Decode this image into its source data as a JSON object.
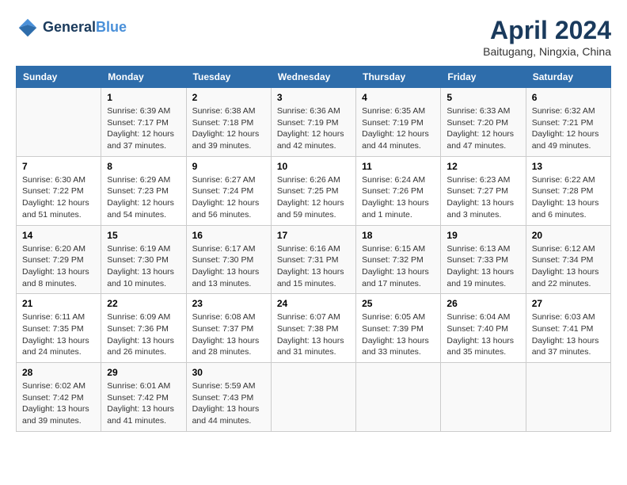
{
  "header": {
    "logo_line1": "General",
    "logo_line2": "Blue",
    "title": "April 2024",
    "location": "Baitugang, Ningxia, China"
  },
  "weekdays": [
    "Sunday",
    "Monday",
    "Tuesday",
    "Wednesday",
    "Thursday",
    "Friday",
    "Saturday"
  ],
  "weeks": [
    [
      {
        "day": "",
        "info": ""
      },
      {
        "day": "1",
        "info": "Sunrise: 6:39 AM\nSunset: 7:17 PM\nDaylight: 12 hours\nand 37 minutes."
      },
      {
        "day": "2",
        "info": "Sunrise: 6:38 AM\nSunset: 7:18 PM\nDaylight: 12 hours\nand 39 minutes."
      },
      {
        "day": "3",
        "info": "Sunrise: 6:36 AM\nSunset: 7:19 PM\nDaylight: 12 hours\nand 42 minutes."
      },
      {
        "day": "4",
        "info": "Sunrise: 6:35 AM\nSunset: 7:19 PM\nDaylight: 12 hours\nand 44 minutes."
      },
      {
        "day": "5",
        "info": "Sunrise: 6:33 AM\nSunset: 7:20 PM\nDaylight: 12 hours\nand 47 minutes."
      },
      {
        "day": "6",
        "info": "Sunrise: 6:32 AM\nSunset: 7:21 PM\nDaylight: 12 hours\nand 49 minutes."
      }
    ],
    [
      {
        "day": "7",
        "info": "Sunrise: 6:30 AM\nSunset: 7:22 PM\nDaylight: 12 hours\nand 51 minutes."
      },
      {
        "day": "8",
        "info": "Sunrise: 6:29 AM\nSunset: 7:23 PM\nDaylight: 12 hours\nand 54 minutes."
      },
      {
        "day": "9",
        "info": "Sunrise: 6:27 AM\nSunset: 7:24 PM\nDaylight: 12 hours\nand 56 minutes."
      },
      {
        "day": "10",
        "info": "Sunrise: 6:26 AM\nSunset: 7:25 PM\nDaylight: 12 hours\nand 59 minutes."
      },
      {
        "day": "11",
        "info": "Sunrise: 6:24 AM\nSunset: 7:26 PM\nDaylight: 13 hours\nand 1 minute."
      },
      {
        "day": "12",
        "info": "Sunrise: 6:23 AM\nSunset: 7:27 PM\nDaylight: 13 hours\nand 3 minutes."
      },
      {
        "day": "13",
        "info": "Sunrise: 6:22 AM\nSunset: 7:28 PM\nDaylight: 13 hours\nand 6 minutes."
      }
    ],
    [
      {
        "day": "14",
        "info": "Sunrise: 6:20 AM\nSunset: 7:29 PM\nDaylight: 13 hours\nand 8 minutes."
      },
      {
        "day": "15",
        "info": "Sunrise: 6:19 AM\nSunset: 7:30 PM\nDaylight: 13 hours\nand 10 minutes."
      },
      {
        "day": "16",
        "info": "Sunrise: 6:17 AM\nSunset: 7:30 PM\nDaylight: 13 hours\nand 13 minutes."
      },
      {
        "day": "17",
        "info": "Sunrise: 6:16 AM\nSunset: 7:31 PM\nDaylight: 13 hours\nand 15 minutes."
      },
      {
        "day": "18",
        "info": "Sunrise: 6:15 AM\nSunset: 7:32 PM\nDaylight: 13 hours\nand 17 minutes."
      },
      {
        "day": "19",
        "info": "Sunrise: 6:13 AM\nSunset: 7:33 PM\nDaylight: 13 hours\nand 19 minutes."
      },
      {
        "day": "20",
        "info": "Sunrise: 6:12 AM\nSunset: 7:34 PM\nDaylight: 13 hours\nand 22 minutes."
      }
    ],
    [
      {
        "day": "21",
        "info": "Sunrise: 6:11 AM\nSunset: 7:35 PM\nDaylight: 13 hours\nand 24 minutes."
      },
      {
        "day": "22",
        "info": "Sunrise: 6:09 AM\nSunset: 7:36 PM\nDaylight: 13 hours\nand 26 minutes."
      },
      {
        "day": "23",
        "info": "Sunrise: 6:08 AM\nSunset: 7:37 PM\nDaylight: 13 hours\nand 28 minutes."
      },
      {
        "day": "24",
        "info": "Sunrise: 6:07 AM\nSunset: 7:38 PM\nDaylight: 13 hours\nand 31 minutes."
      },
      {
        "day": "25",
        "info": "Sunrise: 6:05 AM\nSunset: 7:39 PM\nDaylight: 13 hours\nand 33 minutes."
      },
      {
        "day": "26",
        "info": "Sunrise: 6:04 AM\nSunset: 7:40 PM\nDaylight: 13 hours\nand 35 minutes."
      },
      {
        "day": "27",
        "info": "Sunrise: 6:03 AM\nSunset: 7:41 PM\nDaylight: 13 hours\nand 37 minutes."
      }
    ],
    [
      {
        "day": "28",
        "info": "Sunrise: 6:02 AM\nSunset: 7:42 PM\nDaylight: 13 hours\nand 39 minutes."
      },
      {
        "day": "29",
        "info": "Sunrise: 6:01 AM\nSunset: 7:42 PM\nDaylight: 13 hours\nand 41 minutes."
      },
      {
        "day": "30",
        "info": "Sunrise: 5:59 AM\nSunset: 7:43 PM\nDaylight: 13 hours\nand 44 minutes."
      },
      {
        "day": "",
        "info": ""
      },
      {
        "day": "",
        "info": ""
      },
      {
        "day": "",
        "info": ""
      },
      {
        "day": "",
        "info": ""
      }
    ]
  ]
}
